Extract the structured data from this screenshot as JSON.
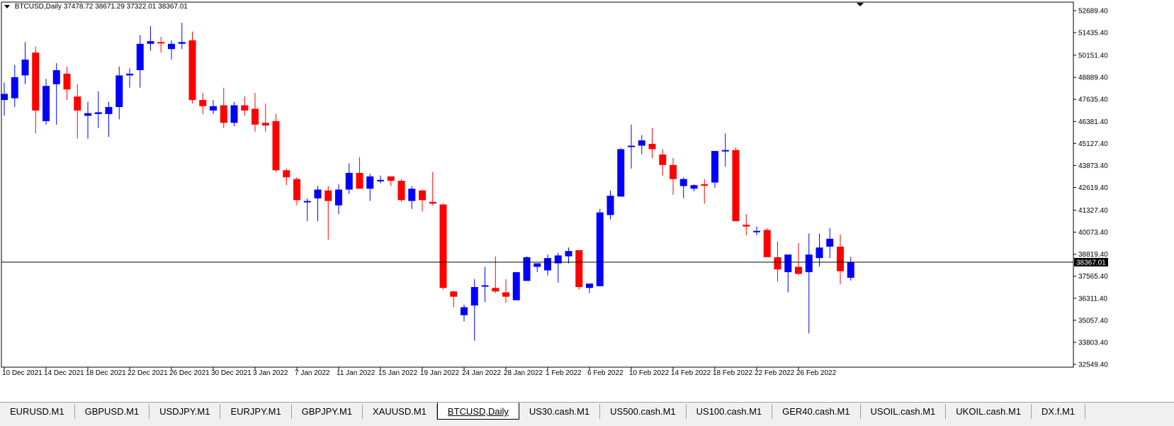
{
  "symbol_info": {
    "symbol": "BTCUSD,Daily",
    "ohlc": "37478.72 38671.29 37322.01 38367.01"
  },
  "colors": {
    "bull": "#0000ff",
    "bear": "#ff0000",
    "price_line": "#000000",
    "background": "#ffffff"
  },
  "chart_data": {
    "type": "candlestick",
    "ylim": [
      32549.4,
      52689.4
    ],
    "y_ticks": [
      "52689.40",
      "51435.40",
      "50151.40",
      "48889.40",
      "47635.40",
      "46381.40",
      "45127.40",
      "43873.40",
      "42619.40",
      "41327.40",
      "40073.40",
      "38819.40",
      "37565.40",
      "36311.40",
      "35057.40",
      "33803.40",
      "32549.40"
    ],
    "current_price_label": "38367.01",
    "current_price": 38367.01,
    "x_labels": [
      "10 Dec 2021",
      "14 Dec 2021",
      "18 Dec 2021",
      "22 Dec 2021",
      "26 Dec 2021",
      "30 Dec 2021",
      "3 Jan 2022",
      "7 Jan 2022",
      "11 Jan 2022",
      "15 Jan 2022",
      "19 Jan 2022",
      "24 Jan 2022",
      "28 Jan 2022",
      "1 Feb 2022",
      "6 Feb 2022",
      "10 Feb 2022",
      "14 Feb 2022",
      "18 Feb 2022",
      "22 Feb 2022",
      "26 Feb 2022"
    ],
    "candles": [
      {
        "o": 47600,
        "h": 48600,
        "l": 46700,
        "c": 47950
      },
      {
        "o": 47700,
        "h": 49600,
        "l": 47200,
        "c": 48900
      },
      {
        "o": 49000,
        "h": 50900,
        "l": 48500,
        "c": 49900
      },
      {
        "o": 50300,
        "h": 50650,
        "l": 45700,
        "c": 47000
      },
      {
        "o": 46400,
        "h": 48800,
        "l": 46200,
        "c": 48400
      },
      {
        "o": 48500,
        "h": 49700,
        "l": 46200,
        "c": 49300
      },
      {
        "o": 49100,
        "h": 49500,
        "l": 47600,
        "c": 48200
      },
      {
        "o": 47800,
        "h": 48500,
        "l": 45400,
        "c": 47000
      },
      {
        "o": 46700,
        "h": 47500,
        "l": 45400,
        "c": 46850
      },
      {
        "o": 46800,
        "h": 48100,
        "l": 46000,
        "c": 46900
      },
      {
        "o": 46800,
        "h": 47500,
        "l": 45500,
        "c": 47200
      },
      {
        "o": 47200,
        "h": 49500,
        "l": 46500,
        "c": 49000
      },
      {
        "o": 49000,
        "h": 49400,
        "l": 48300,
        "c": 49100
      },
      {
        "o": 49300,
        "h": 51300,
        "l": 48300,
        "c": 50800
      },
      {
        "o": 50800,
        "h": 51800,
        "l": 50400,
        "c": 50950
      },
      {
        "o": 50900,
        "h": 51200,
        "l": 50300,
        "c": 50850
      },
      {
        "o": 50500,
        "h": 51000,
        "l": 49900,
        "c": 50800
      },
      {
        "o": 50800,
        "h": 52000,
        "l": 50500,
        "c": 50900
      },
      {
        "o": 51000,
        "h": 51500,
        "l": 47400,
        "c": 47600
      },
      {
        "o": 47600,
        "h": 48000,
        "l": 46800,
        "c": 47250
      },
      {
        "o": 47000,
        "h": 47600,
        "l": 46800,
        "c": 47250
      },
      {
        "o": 47300,
        "h": 48300,
        "l": 46000,
        "c": 46300
      },
      {
        "o": 46300,
        "h": 47500,
        "l": 46100,
        "c": 47300
      },
      {
        "o": 47300,
        "h": 47800,
        "l": 46700,
        "c": 47000
      },
      {
        "o": 47100,
        "h": 48000,
        "l": 45800,
        "c": 46200
      },
      {
        "o": 46300,
        "h": 47400,
        "l": 45800,
        "c": 46150
      },
      {
        "o": 46400,
        "h": 46800,
        "l": 43500,
        "c": 43600
      },
      {
        "o": 43600,
        "h": 43700,
        "l": 42750,
        "c": 43200
      },
      {
        "o": 43100,
        "h": 43200,
        "l": 41600,
        "c": 41900
      },
      {
        "o": 41800,
        "h": 42000,
        "l": 40700,
        "c": 41850
      },
      {
        "o": 42000,
        "h": 42700,
        "l": 40700,
        "c": 42500
      },
      {
        "o": 42450,
        "h": 42700,
        "l": 39650,
        "c": 41850
      },
      {
        "o": 41600,
        "h": 42800,
        "l": 41100,
        "c": 42500
      },
      {
        "o": 42500,
        "h": 44000,
        "l": 42250,
        "c": 43450
      },
      {
        "o": 43450,
        "h": 44350,
        "l": 42550,
        "c": 42550
      },
      {
        "o": 42550,
        "h": 43400,
        "l": 41850,
        "c": 43250
      },
      {
        "o": 43050,
        "h": 43300,
        "l": 42850,
        "c": 43050
      },
      {
        "o": 43250,
        "h": 43200,
        "l": 42700,
        "c": 43000
      },
      {
        "o": 43000,
        "h": 43100,
        "l": 41800,
        "c": 41900
      },
      {
        "o": 41850,
        "h": 42700,
        "l": 41400,
        "c": 42550
      },
      {
        "o": 42450,
        "h": 42500,
        "l": 41250,
        "c": 41900
      },
      {
        "o": 41800,
        "h": 43500,
        "l": 41600,
        "c": 41700
      },
      {
        "o": 41650,
        "h": 41700,
        "l": 36800,
        "c": 36900
      },
      {
        "o": 36700,
        "h": 36750,
        "l": 35800,
        "c": 36400
      },
      {
        "o": 35350,
        "h": 35950,
        "l": 35000,
        "c": 35800
      },
      {
        "o": 35900,
        "h": 37400,
        "l": 33900,
        "c": 36950
      },
      {
        "o": 37000,
        "h": 38100,
        "l": 36100,
        "c": 37050
      },
      {
        "o": 36900,
        "h": 38700,
        "l": 36600,
        "c": 36700
      },
      {
        "o": 36650,
        "h": 37400,
        "l": 36050,
        "c": 36400
      },
      {
        "o": 36200,
        "h": 37800,
        "l": 36200,
        "c": 37800
      },
      {
        "o": 37300,
        "h": 38700,
        "l": 37300,
        "c": 38650
      },
      {
        "o": 38100,
        "h": 38300,
        "l": 37800,
        "c": 38300
      },
      {
        "o": 37900,
        "h": 38800,
        "l": 37600,
        "c": 38600
      },
      {
        "o": 38300,
        "h": 38900,
        "l": 37200,
        "c": 38750
      },
      {
        "o": 38700,
        "h": 39200,
        "l": 38300,
        "c": 39000
      },
      {
        "o": 39050,
        "h": 39050,
        "l": 36800,
        "c": 36950
      },
      {
        "o": 36900,
        "h": 37000,
        "l": 36600,
        "c": 37150
      },
      {
        "o": 37000,
        "h": 41400,
        "l": 37050,
        "c": 41200
      },
      {
        "o": 41050,
        "h": 42450,
        "l": 40800,
        "c": 42150
      },
      {
        "o": 42100,
        "h": 44850,
        "l": 42150,
        "c": 44800
      },
      {
        "o": 44950,
        "h": 46200,
        "l": 43700,
        "c": 45000
      },
      {
        "o": 45000,
        "h": 45600,
        "l": 44500,
        "c": 45300
      },
      {
        "o": 45100,
        "h": 46000,
        "l": 44300,
        "c": 44800
      },
      {
        "o": 44500,
        "h": 44800,
        "l": 43300,
        "c": 43900
      },
      {
        "o": 43900,
        "h": 44300,
        "l": 42200,
        "c": 43100
      },
      {
        "o": 42700,
        "h": 43200,
        "l": 42000,
        "c": 43100
      },
      {
        "o": 42550,
        "h": 42800,
        "l": 42400,
        "c": 42750
      },
      {
        "o": 42800,
        "h": 43100,
        "l": 41700,
        "c": 42750
      },
      {
        "o": 42900,
        "h": 44600,
        "l": 42600,
        "c": 44700
      },
      {
        "o": 44700,
        "h": 45700,
        "l": 43800,
        "c": 44750
      },
      {
        "o": 44750,
        "h": 44900,
        "l": 40700,
        "c": 40700
      },
      {
        "o": 40500,
        "h": 41100,
        "l": 39900,
        "c": 40400
      },
      {
        "o": 40150,
        "h": 40400,
        "l": 39900,
        "c": 40150
      },
      {
        "o": 40200,
        "h": 40300,
        "l": 39250,
        "c": 38650
      },
      {
        "o": 38650,
        "h": 39550,
        "l": 37250,
        "c": 37950
      },
      {
        "o": 37800,
        "h": 38450,
        "l": 36650,
        "c": 38800
      },
      {
        "o": 38100,
        "h": 39450,
        "l": 37650,
        "c": 37700
      },
      {
        "o": 37800,
        "h": 40000,
        "l": 34300,
        "c": 38800
      },
      {
        "o": 38600,
        "h": 40000,
        "l": 38100,
        "c": 39200
      },
      {
        "o": 39250,
        "h": 40300,
        "l": 38600,
        "c": 39700
      },
      {
        "o": 39250,
        "h": 39950,
        "l": 37100,
        "c": 37850
      },
      {
        "o": 37478.72,
        "h": 38671.29,
        "l": 37322.01,
        "c": 38367.01
      }
    ]
  },
  "tabs": [
    {
      "label": "EURUSD.M1",
      "active": false
    },
    {
      "label": "GBPUSD.M1",
      "active": false
    },
    {
      "label": "USDJPY.M1",
      "active": false
    },
    {
      "label": "EURJPY.M1",
      "active": false
    },
    {
      "label": "GBPJPY.M1",
      "active": false
    },
    {
      "label": "XAUUSD.M1",
      "active": false
    },
    {
      "label": "BTCUSD,Daily",
      "active": true
    },
    {
      "label": "US30.cash.M1",
      "active": false
    },
    {
      "label": "US500.cash.M1",
      "active": false
    },
    {
      "label": "US100.cash.M1",
      "active": false
    },
    {
      "label": "GER40.cash.M1",
      "active": false
    },
    {
      "label": "USOIL.cash.M1",
      "active": false
    },
    {
      "label": "UKOIL.cash.M1",
      "active": false
    },
    {
      "label": "DX.f.M1",
      "active": false
    }
  ]
}
